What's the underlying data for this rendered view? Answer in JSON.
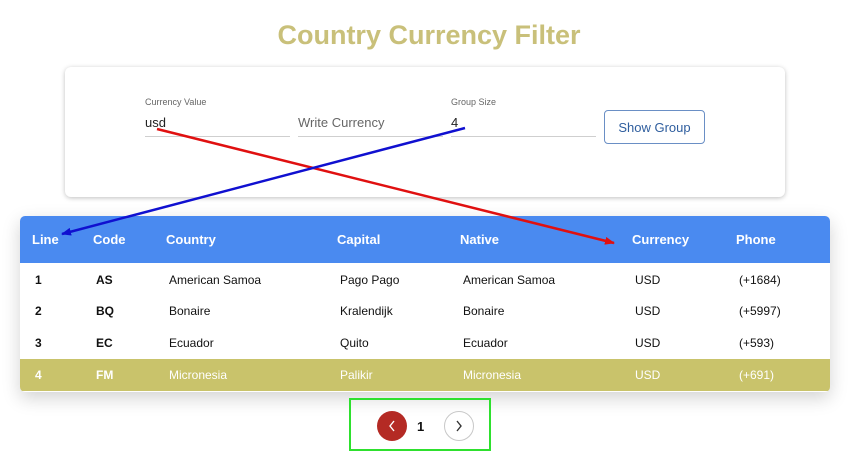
{
  "title": "Country Currency Filter",
  "filter": {
    "currency_label": "Currency Value",
    "currency_value": "usd",
    "write_placeholder": "Write Currency",
    "group_label": "Group Size",
    "group_value": "4",
    "show_group_label": "Show Group"
  },
  "table": {
    "headers": [
      "Line",
      "Code",
      "Country",
      "Capital",
      "Native",
      "Currency",
      "Phone"
    ],
    "rows": [
      {
        "line": "1",
        "code": "AS",
        "country": "American Samoa",
        "capital": "Pago Pago",
        "native": "American Samoa",
        "currency": "USD",
        "phone": "(+1684)"
      },
      {
        "line": "2",
        "code": "BQ",
        "country": "Bonaire",
        "capital": "Kralendijk",
        "native": "Bonaire",
        "currency": "USD",
        "phone": "(+5997)"
      },
      {
        "line": "3",
        "code": "EC",
        "country": "Ecuador",
        "capital": "Quito",
        "native": "Ecuador",
        "currency": "USD",
        "phone": "(+593)"
      },
      {
        "line": "4",
        "code": "FM",
        "country": "Micronesia",
        "capital": "Palikir",
        "native": "Micronesia",
        "currency": "USD",
        "phone": "(+691)"
      }
    ],
    "selected_row": "4"
  },
  "pagination": {
    "current_page": "1",
    "prev_icon": "chevron-left-icon",
    "next_icon": "chevron-right-icon"
  },
  "colors": {
    "title": "#c9c07a",
    "header_bg": "#4a8af0",
    "selected_row_bg": "#c9c36b",
    "prev_button": "#b42a24",
    "pager_outline": "#2ee02e",
    "annotation_red": "#e01010",
    "annotation_blue": "#1010d0"
  }
}
